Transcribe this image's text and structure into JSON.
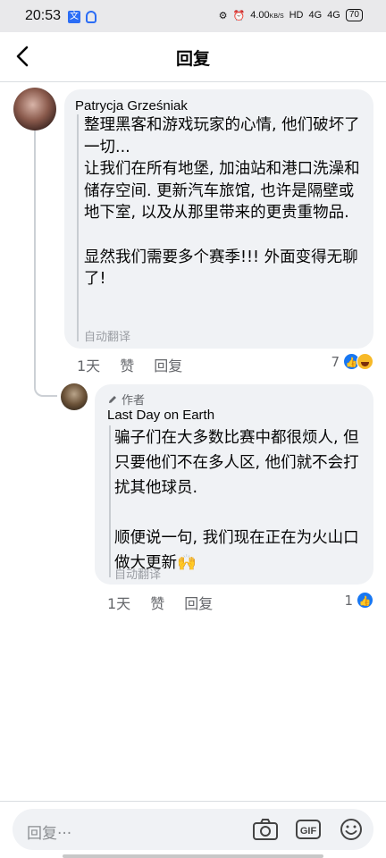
{
  "status": {
    "time": "20:53",
    "net_speed": "4.00",
    "net_unit": "KB/S",
    "hd": "HD",
    "signal1": "4G",
    "signal2": "4G",
    "battery": "70"
  },
  "header": {
    "title": "回复"
  },
  "comment": {
    "author": "Patrycja Grześniak",
    "text": "整理黑客和游戏玩家的心情, 他们破坏了一切...\n让我们在所有地堡, 加油站和港口洗澡和储存空间. 更新汽车旅馆, 也许是隔壁或地下室, 以及从那里带来的更贵重物品.\n\n显然我们需要多个赛季!!! 外面变得无聊了!",
    "translated_label": "自动翻译",
    "time": "1天",
    "like_label": "赞",
    "reply_label": "回复",
    "reaction_count": "7"
  },
  "reply": {
    "author_badge": "作者",
    "author": "Last Day on Earth",
    "text": "骗子们在大多数比赛中都很烦人, 但只要他们不在多人区, 他们就不会打扰其他球员.\n\n顺便说一句, 我们现在正在为火山口做大更新🙌",
    "translated_label": "自动翻译",
    "time": "1天",
    "like_label": "赞",
    "reply_label": "回复",
    "reaction_count": "1"
  },
  "composer": {
    "placeholder": "回复···",
    "gif_label": "GIF"
  },
  "colors": {
    "accent": "#1877f2",
    "bubble": "#f0f2f5",
    "secondary_text": "#65676b"
  }
}
